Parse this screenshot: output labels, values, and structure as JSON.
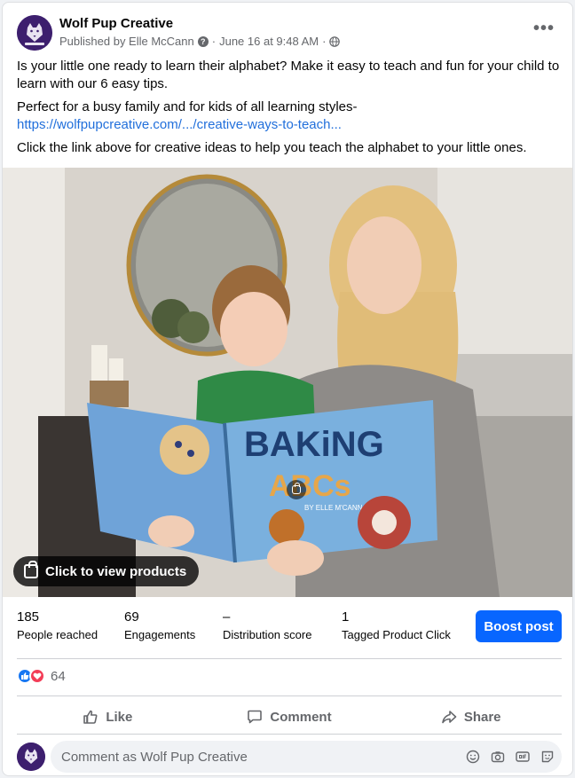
{
  "post": {
    "page_name": "Wolf Pup Creative",
    "published_by": "Published by Elle McCann",
    "date": "June 16 at 9:48 AM",
    "separator": "·",
    "more_label": "•••",
    "text_line1": "Is your little one ready to learn their alphabet? Make it easy to teach and fun for your child to learn with our 6 easy tips.",
    "text_line2": "Perfect for a busy family and for kids of all learning styles-",
    "link": "https://wolfpupcreative.com/.../creative-ways-to-teach...",
    "text_line3": "Click the link above for creative ideas to help you teach the alphabet to your little ones."
  },
  "photo": {
    "view_products_label": "Click to view products",
    "book_title": "BAKiNG",
    "book_subtitle": "ABCs",
    "book_author": "BY ELLE M'CANN"
  },
  "stats": [
    {
      "value": "185",
      "label": "People reached"
    },
    {
      "value": "69",
      "label": "Engagements"
    },
    {
      "value": "–",
      "label": "Distribution score"
    },
    {
      "value": "1",
      "label": "Tagged Product Click"
    }
  ],
  "boost_label": "Boost post",
  "reactions": {
    "count": "64"
  },
  "actions": {
    "like": "Like",
    "comment": "Comment",
    "share": "Share"
  },
  "comment": {
    "placeholder": "Comment as Wolf Pup Creative"
  },
  "colors": {
    "accent": "#0866ff",
    "link": "#216fdb",
    "brand": "#3d1f6e"
  }
}
